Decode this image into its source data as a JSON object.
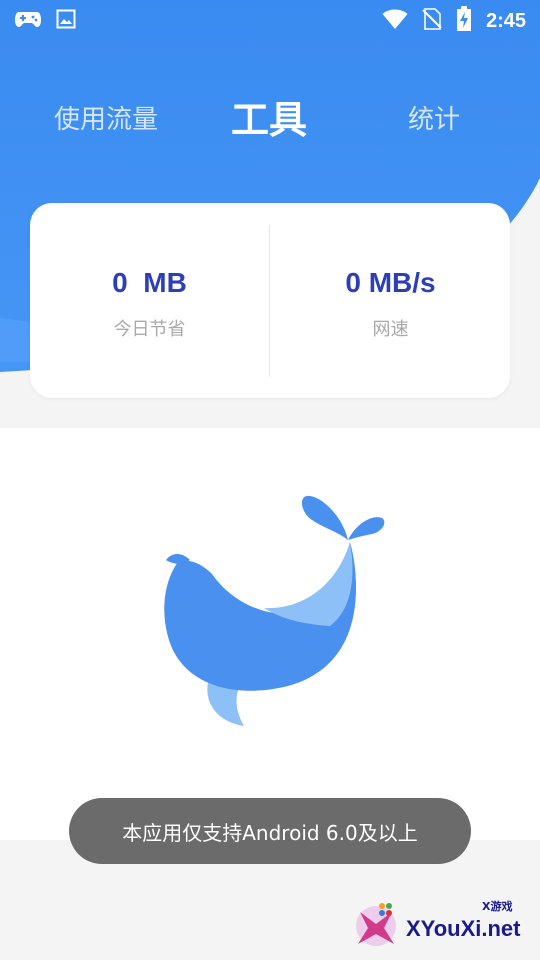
{
  "status_bar": {
    "time": "2:45",
    "left_icons": [
      "gamepad-icon",
      "image-icon"
    ],
    "right_icons": [
      "wifi-icon",
      "no-sim-icon",
      "battery-charging-icon"
    ]
  },
  "tabs": [
    {
      "label": "使用流量",
      "active": false
    },
    {
      "label": "工具",
      "active": true
    },
    {
      "label": "统计",
      "active": false
    }
  ],
  "stats": {
    "saved_value": "0  MB",
    "saved_label": "今日节省",
    "speed_value": "0 MB/s",
    "speed_label": "网速"
  },
  "toast": {
    "message": "本应用仅支持Android 6.0及以上"
  },
  "watermark": {
    "brand": "XYouXi.net",
    "tag": "X游戏"
  },
  "colors": {
    "primary_blue": "#3b8ef0",
    "value_text": "#2c3fb8",
    "whale_body": "#4a90ee",
    "whale_light": "#8cc0f7"
  }
}
